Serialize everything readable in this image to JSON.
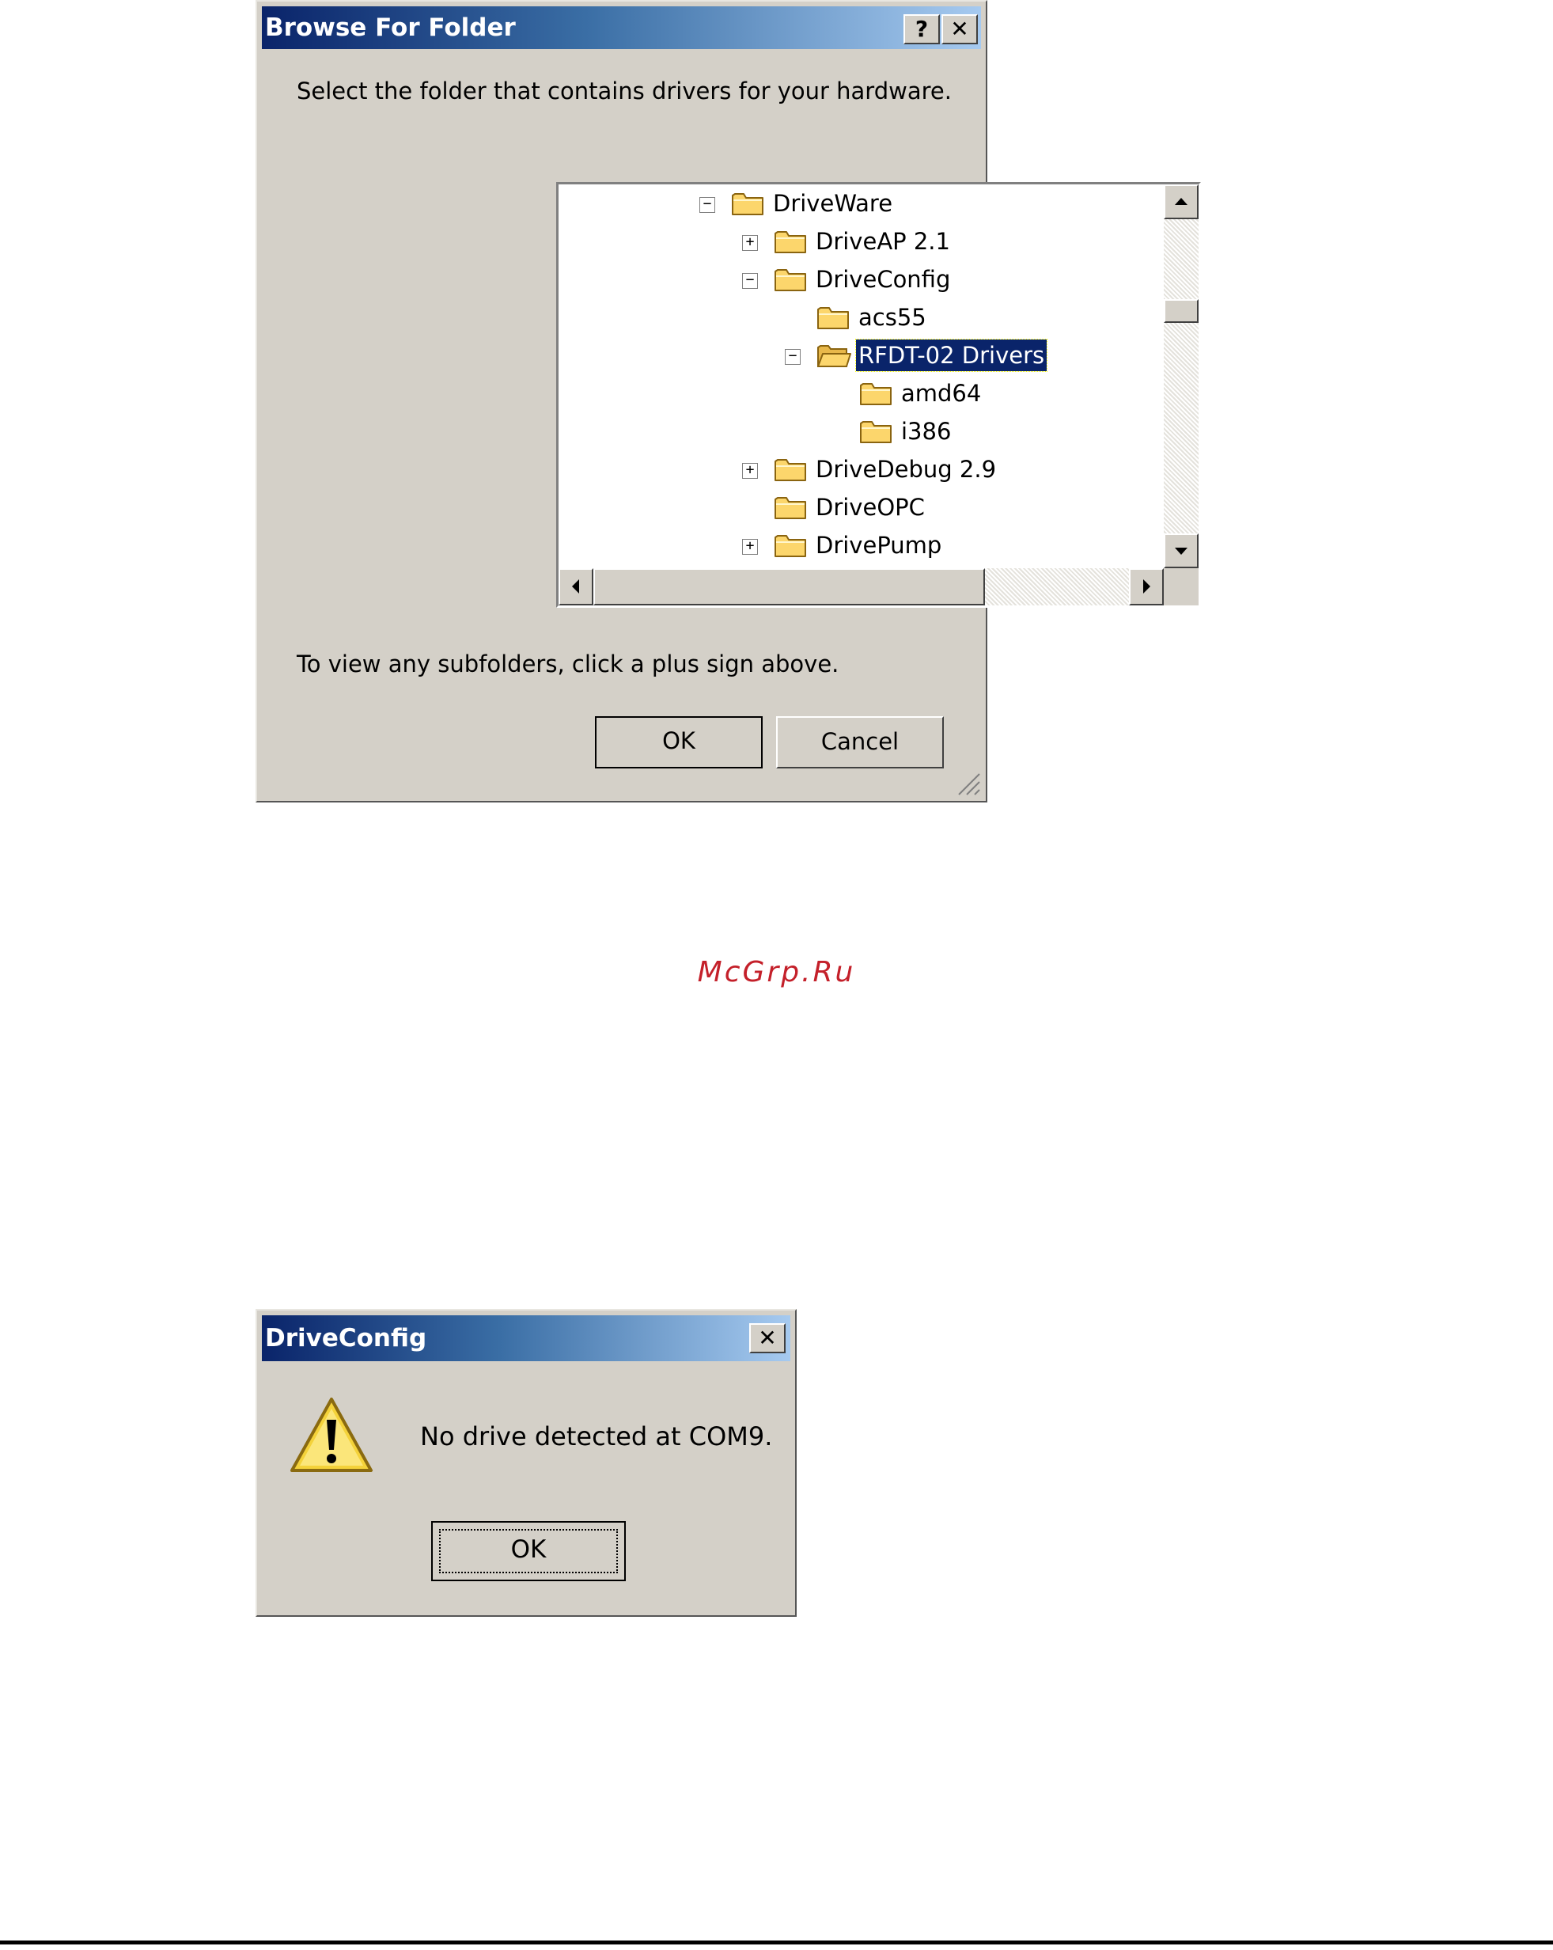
{
  "browse_dialog": {
    "title": "Browse For Folder",
    "help_button": "?",
    "close_button": "✕",
    "instruction": "Select the folder that contains drivers for your hardware.",
    "tree": [
      {
        "label": "DriveWare",
        "level": 0,
        "expander": "−",
        "selected": false
      },
      {
        "label": "DriveAP 2.1",
        "level": 1,
        "expander": "+",
        "selected": false
      },
      {
        "label": "DriveConfig",
        "level": 1,
        "expander": "−",
        "selected": false
      },
      {
        "label": "acs55",
        "level": 2,
        "expander": "",
        "selected": false
      },
      {
        "label": "RFDT-02 Drivers",
        "level": 2,
        "expander": "−",
        "selected": true
      },
      {
        "label": "amd64",
        "level": 3,
        "expander": "",
        "selected": false
      },
      {
        "label": "i386",
        "level": 3,
        "expander": "",
        "selected": false
      },
      {
        "label": "DriveDebug 2.9",
        "level": 1,
        "expander": "+",
        "selected": false
      },
      {
        "label": "DriveOPC",
        "level": 1,
        "expander": "",
        "selected": false
      },
      {
        "label": "DrivePump",
        "level": 1,
        "expander": "+",
        "selected": false
      }
    ],
    "hint": "To view any subfolders, click a plus sign above.",
    "ok_label": "OK",
    "cancel_label": "Cancel"
  },
  "message_dialog": {
    "title": "DriveConfig",
    "close_button": "✕",
    "message": "No drive detected at COM9.",
    "ok_label": "OK"
  },
  "watermark": "McGrp.Ru",
  "colors": {
    "dialog_face": "#d4d0c8",
    "title_start": "#0a246a",
    "title_end": "#a6caf0",
    "selection": "#0a246a",
    "watermark": "#c4202a",
    "folder_fill": "#fcd66c"
  }
}
